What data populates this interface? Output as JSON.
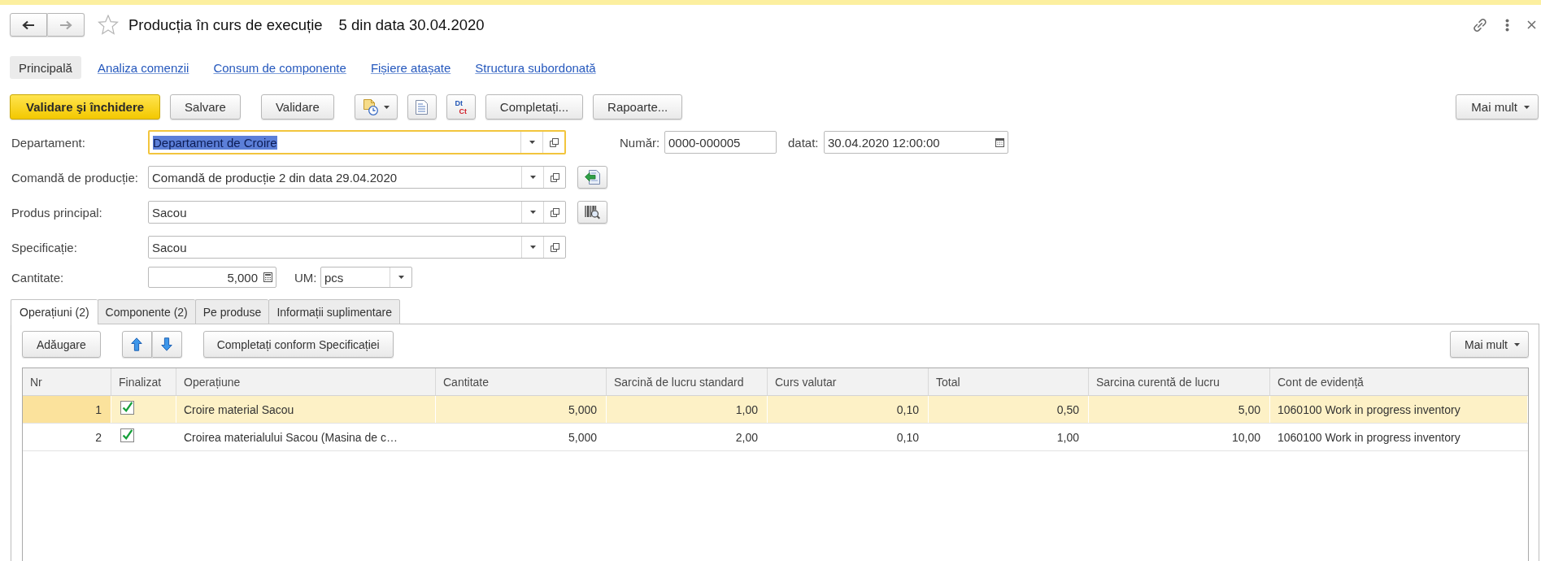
{
  "window": {
    "title": "Producția în curs de execuție",
    "subtitle": "5 din data 30.04.2020",
    "favorite": false,
    "back": {
      "disabled": false
    },
    "forward": {
      "disabled": true
    }
  },
  "sections": [
    {
      "label": "Principală",
      "selected": true
    },
    {
      "label": "Analiza comenzii",
      "selected": false
    },
    {
      "label": "Consum de componente",
      "selected": false
    },
    {
      "label": "Fișiere atașate",
      "selected": false
    },
    {
      "label": "Structura subordonată",
      "selected": false
    }
  ],
  "toolbar": {
    "buttons": [
      {
        "kind": "primary",
        "label": "Validare şi închidere"
      },
      {
        "kind": "plain",
        "label": "Salvare"
      },
      {
        "kind": "plain",
        "label": "Validare"
      },
      {
        "kind": "icon-menu"
      },
      {
        "kind": "icon"
      },
      {
        "kind": "ledger",
        "top": "Dt",
        "bottom": "Ct"
      },
      {
        "kind": "plain",
        "label": "Completați..."
      },
      {
        "kind": "plain",
        "label": "Rapoarte..."
      }
    ],
    "more": "Mai mult"
  },
  "fields": [
    {
      "label": "Departament:",
      "value": "Departament de Croire",
      "focused": true
    },
    {
      "label": "Comandă de producție:",
      "value": "Comandă de producție 2 din data 29.04.2020",
      "focused": false,
      "action": {
        "kind": "fill-from"
      }
    },
    {
      "label": "Produs principal:",
      "value": "Sacou",
      "focused": false,
      "action": {
        "kind": "barcode-search"
      }
    },
    {
      "label": "Specificație:",
      "value": "Sacou",
      "focused": false
    }
  ],
  "number": {
    "label": "Număr:",
    "value": "0000-000005"
  },
  "date": {
    "label": "datat:",
    "value": "30.04.2020 12:00:00"
  },
  "quantity": {
    "label": "Cantitate:",
    "value": "5,000"
  },
  "unit": {
    "label": "UM:",
    "value": "pcs"
  },
  "tabs": [
    {
      "label": "Operațiuni (2)",
      "selected": true
    },
    {
      "label": "Componente (2)",
      "selected": false
    },
    {
      "label": "Pe produse",
      "selected": false
    },
    {
      "label": "Informații suplimentare",
      "selected": false
    }
  ],
  "table_toolbar": {
    "add": "Adăugare",
    "fill": "Completați conform Specificației",
    "more": "Mai mult"
  },
  "table": {
    "columns": [
      {
        "label": "Nr",
        "kind": "number"
      },
      {
        "label": "Finalizat",
        "kind": "check"
      },
      {
        "label": "Operațiune",
        "kind": "text"
      },
      {
        "label": "Cantitate",
        "kind": "number"
      },
      {
        "label": "Sarcină de lucru standard",
        "kind": "number"
      },
      {
        "label": "Curs valutar",
        "kind": "number"
      },
      {
        "label": "Total",
        "kind": "number"
      },
      {
        "label": "Sarcina curentă de lucru",
        "kind": "number"
      },
      {
        "label": "Cont de evidență",
        "kind": "text"
      }
    ],
    "rows": [
      {
        "selected": true,
        "cells": [
          "1",
          {
            "checked": true
          },
          "Croire material Sacou",
          "5,000",
          "1,00",
          "0,10",
          "0,50",
          "5,00",
          "1060100 Work in progress inventory"
        ]
      },
      {
        "selected": false,
        "cells": [
          "2",
          {
            "checked": true
          },
          "Croirea materialului Sacou (Masina de c…",
          "5,000",
          "2,00",
          "0,10",
          "1,00",
          "10,00",
          "1060100 Work in progress inventory"
        ]
      }
    ]
  }
}
